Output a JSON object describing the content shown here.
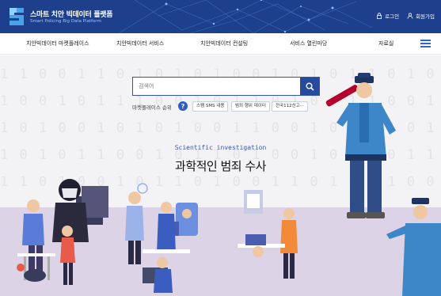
{
  "brand": {
    "title": "스마트 치안 빅데이터 플랫폼",
    "subtitle": "Smart Policing Big Data Platform",
    "icon": "logo-s-icon"
  },
  "header": {
    "login_label": "로그인",
    "signup_label": "회원가입",
    "login_icon": "lock-icon",
    "signup_icon": "user-icon"
  },
  "nav": {
    "items": [
      {
        "label": "치안빅데이터 마켓플레이스"
      },
      {
        "label": "치안빅데이터 서비스"
      },
      {
        "label": "치안빅데이터 컨설팅"
      },
      {
        "label": "서비스 열린마당"
      },
      {
        "label": "자료실"
      }
    ],
    "menu_icon": "hamburger-menu-icon"
  },
  "search": {
    "placeholder": "검색어",
    "button_icon": "search-icon"
  },
  "ranking": {
    "label": "마켓플레이스 순위",
    "help_glyph": "?",
    "chips": [
      {
        "label": "스팸 SMS 내용"
      },
      {
        "label": "범죄 행위 데이터"
      },
      {
        "label": "전국112신고···"
      }
    ]
  },
  "hero": {
    "english_title": "Scientific investigation",
    "korean_title": "과학적인 범죄 수사",
    "binary_rows": [
      "1 1 0 0 1 1 0 1 0 1 0 1 0 0 1 0 1 0 1 1 0 1 0 1 0 0 1 1",
      "1 0 0 1 0 1 1 1 0 0 1 0 1 1 0 1 0 0 1 1 0 0 1 0 1 0 1",
      "1 0 1 0 0 1 0 1 0 1 0 0 1 1 0 0 1 0 1 1 1 0 1 0 0 1 0 1",
      "1 0 1 0 1 1 0 0 1 0 1 1 0 1 0 0 1 0 1 0 0 1 1 0 1 0 1",
      "1 1 0 1 0 0 1 0 1 1 0 1 0 0 1 1 0 1 0 1 1 0 0 1 0 1 0"
    ]
  },
  "colors": {
    "header_bg": "#1d3f8c",
    "accent": "#264a9e",
    "hero_bg": "#f3f3f6",
    "floor": "#ddd3e6"
  }
}
